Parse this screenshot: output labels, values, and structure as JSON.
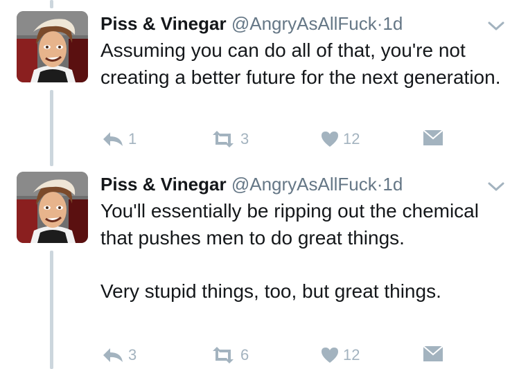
{
  "tweets": [
    {
      "name": "Piss & Vinegar",
      "handle": "@AngryAsAllFuck",
      "separator": "·",
      "time": "1d",
      "text": "Assuming you can do all of that, you're not creating a better future for the next generation.",
      "replies": "1",
      "retweets": "3",
      "likes": "12"
    },
    {
      "name": "Piss & Vinegar",
      "handle": "@AngryAsAllFuck",
      "separator": "·",
      "time": "1d",
      "text": "You'll essentially be ripping out the chemical that pushes men to do great things.\n\nVery stupid things, too, but great things.",
      "replies": "3",
      "retweets": "6",
      "likes": "12"
    }
  ],
  "colors": {
    "thread_line": "#ccd6dd",
    "action_gray": "#a3b3bf",
    "meta_gray": "#657786",
    "text": "#14171a"
  },
  "icons": [
    "reply-icon",
    "retweet-icon",
    "heart-icon",
    "direct-message-icon",
    "chevron-down-icon"
  ]
}
